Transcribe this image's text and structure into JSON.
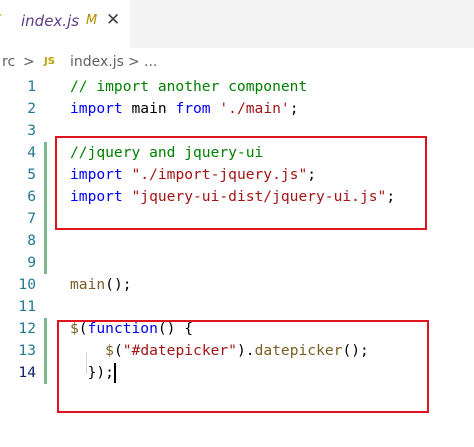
{
  "tab": {
    "lang_icon": "̸",
    "filename": "index.js",
    "modified_flag": "M",
    "close_glyph": "✕"
  },
  "breadcrumb": {
    "root": "rc",
    "sep1": ">",
    "js_badge": "JS",
    "file": "index.js",
    "sep2": ">",
    "ellipsis": "..."
  },
  "lines": [
    {
      "num": "1",
      "tokens": [
        {
          "t": "// import another component",
          "c": "c-comment"
        }
      ]
    },
    {
      "num": "2",
      "tokens": [
        {
          "t": "import",
          "c": "c-kw"
        },
        {
          "t": " main ",
          "c": ""
        },
        {
          "t": "from",
          "c": "c-kw"
        },
        {
          "t": " ",
          "c": ""
        },
        {
          "t": "'./main'",
          "c": "c-str"
        },
        {
          "t": ";",
          "c": ""
        }
      ]
    },
    {
      "num": "3",
      "tokens": []
    },
    {
      "num": "4",
      "tokens": [
        {
          "t": "//jquery and jquery-ui",
          "c": "c-comment"
        }
      ]
    },
    {
      "num": "5",
      "tokens": [
        {
          "t": "import",
          "c": "c-kw"
        },
        {
          "t": " ",
          "c": ""
        },
        {
          "t": "\"./import-jquery.js\"",
          "c": "c-str"
        },
        {
          "t": ";",
          "c": ""
        }
      ]
    },
    {
      "num": "6",
      "tokens": [
        {
          "t": "import",
          "c": "c-kw"
        },
        {
          "t": " ",
          "c": ""
        },
        {
          "t": "\"jquery-ui-dist/jquery-ui.js\"",
          "c": "c-str"
        },
        {
          "t": ";",
          "c": ""
        }
      ]
    },
    {
      "num": "7",
      "tokens": []
    },
    {
      "num": "8",
      "tokens": []
    },
    {
      "num": "9",
      "tokens": []
    },
    {
      "num": "10",
      "tokens": [
        {
          "t": "main",
          "c": "c-fn"
        },
        {
          "t": "();",
          "c": ""
        }
      ]
    },
    {
      "num": "11",
      "tokens": []
    },
    {
      "num": "12",
      "tokens": [
        {
          "t": "$",
          "c": "c-fn"
        },
        {
          "t": "(",
          "c": ""
        },
        {
          "t": "function",
          "c": "c-kw"
        },
        {
          "t": "() {",
          "c": ""
        }
      ]
    },
    {
      "num": "13",
      "tokens": [
        {
          "t": "    ",
          "c": ""
        },
        {
          "t": "$",
          "c": "c-fn"
        },
        {
          "t": "(",
          "c": ""
        },
        {
          "t": "\"#datepicker\"",
          "c": "c-str"
        },
        {
          "t": ").",
          "c": ""
        },
        {
          "t": "datepicker",
          "c": "c-fn"
        },
        {
          "t": "();",
          "c": ""
        }
      ]
    },
    {
      "num": "14",
      "tokens": [
        {
          "t": "  });",
          "c": ""
        }
      ]
    }
  ],
  "active_line": "14",
  "modified_lines": [
    "4",
    "5",
    "6",
    "7",
    "8",
    "9",
    "12",
    "13",
    "14"
  ],
  "colors": {
    "highlight_border": "#e0141e",
    "gutter_modified": "#81b88b",
    "keyword": "#0000ff",
    "string": "#a31515",
    "comment": "#008000",
    "function": "#795e26"
  }
}
